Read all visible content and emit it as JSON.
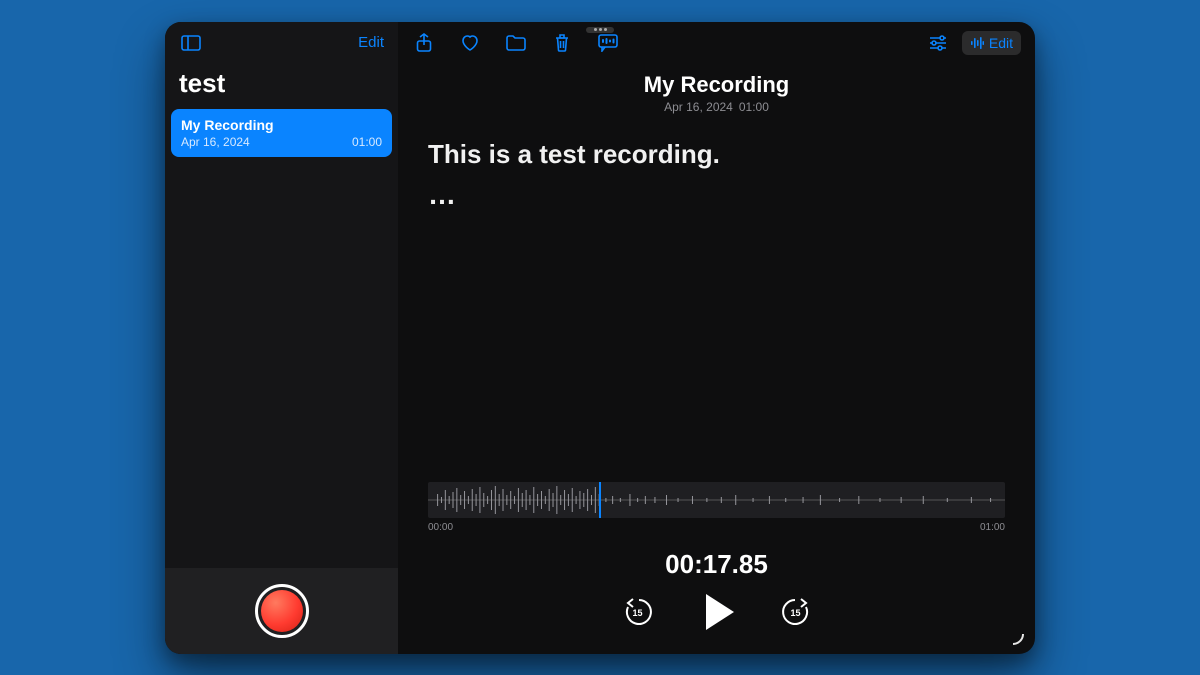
{
  "colors": {
    "accent": "#0a84ff",
    "record": "#ff3b30"
  },
  "sidebar": {
    "edit_label": "Edit",
    "title": "test",
    "items": [
      {
        "name": "My Recording",
        "date": "Apr 16, 2024",
        "duration": "01:00",
        "selected": true
      }
    ]
  },
  "main": {
    "edit_label": "Edit",
    "title": "My Recording",
    "date": "Apr 16, 2024",
    "duration": "01:00",
    "transcript_line": "This is a test recording.",
    "transcript_pending": "…",
    "waveform": {
      "start_label": "00:00",
      "end_label": "01:00"
    },
    "current_time": "00:17.85",
    "skip_seconds": "15"
  }
}
